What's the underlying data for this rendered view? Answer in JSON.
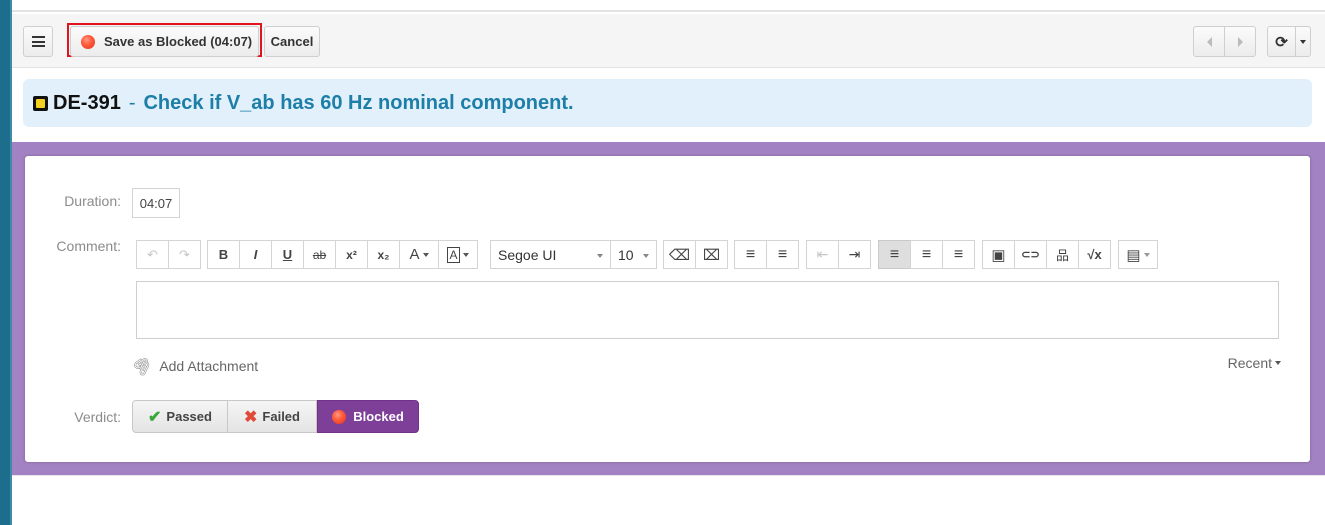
{
  "toolbar": {
    "menu_icon": "hamburger-icon",
    "save_label": "Save as Blocked (04:07)",
    "cancel_label": "Cancel",
    "prev_icon": "triangle-left-icon",
    "next_icon": "triangle-right-icon",
    "refresh_icon": "refresh-icon",
    "refresh_glyph": "⟳"
  },
  "test_case": {
    "id": "DE-391",
    "dash": "-",
    "title": "Check if V_ab has 60 Hz nominal component."
  },
  "form": {
    "duration_label": "Duration:",
    "duration_value": "04:07",
    "comment_label": "Comment:",
    "editor": {
      "font_family": "Segoe UI",
      "font_size": "10",
      "buttons": {
        "undo": "↶",
        "redo": "↷",
        "bold": "B",
        "italic": "I",
        "underline": "U",
        "strike": "ab",
        "superscript": "x²",
        "subscript": "x₂",
        "font_color": "A",
        "highlight": "A",
        "eraser": "⌫",
        "clear_format": "⌧",
        "ordered_list": "≡",
        "unordered_list": "≡",
        "outdent": "⇤",
        "indent": "⇥",
        "align_left": "≡",
        "align_center": "≡",
        "align_right": "≡",
        "image": "▣",
        "link": "⊂⊃",
        "hierarchy": "品",
        "formula": "√x",
        "table": "▤"
      }
    },
    "attachment_label": "Add Attachment",
    "recent_label": "Recent",
    "verdict_label": "Verdict:",
    "verdicts": [
      {
        "label": "Passed",
        "icon": "checkmark-icon",
        "glyph": "✔"
      },
      {
        "label": "Failed",
        "icon": "x-icon",
        "glyph": "✖"
      },
      {
        "label": "Blocked",
        "icon": "red-dot-icon",
        "selected": true
      }
    ]
  },
  "colors": {
    "accent_purple": "#7d3f98",
    "panel_purple": "#a382c3",
    "title_blue": "#1d7ea8",
    "title_bg": "#e1f0fb",
    "highlight_red": "#e0141e"
  }
}
